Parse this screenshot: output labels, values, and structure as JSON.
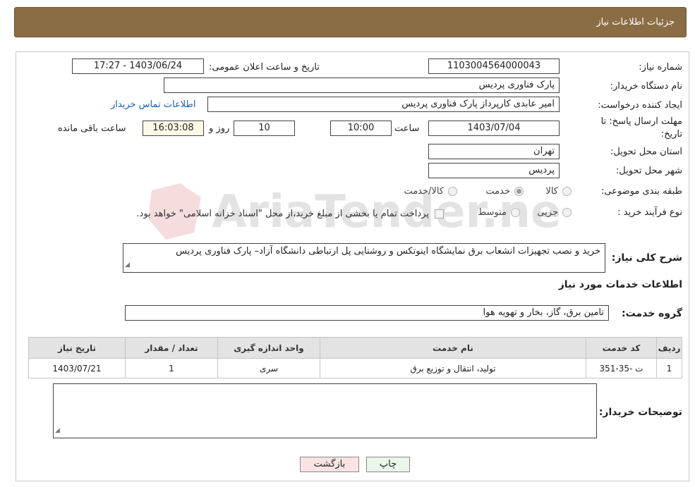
{
  "header": {
    "title": "جزئیات اطلاعات نیاز"
  },
  "fields": {
    "need_number_label": "شماره نیاز:",
    "need_number": "1103004564000043",
    "announce_label": "تاریخ و ساعت اعلان عمومی:",
    "announce_value": "1403/06/24 - 17:27",
    "buyer_org_label": "نام دستگاه خریدار:",
    "buyer_org": "پارک فناوری پردیس",
    "creator_label": "ایجاد کننده درخواست:",
    "creator": "امیر عابدی کارپرداز پارک فناوری پردیس",
    "contact_link": "اطلاعات تماس خریدار",
    "deadline_label_1": "مهلت ارسال پاسخ: تا",
    "deadline_label_2": "تاریخ:",
    "deadline_date": "1403/07/04",
    "time_label": "ساعت",
    "deadline_time": "10:00",
    "days_value": "10",
    "days_label": "روز و",
    "remaining_value": "16:03:08",
    "remaining_label": "ساعت باقی مانده",
    "province_label": "استان محل تحویل:",
    "province": "تهران",
    "city_label": "شهر محل تحویل:",
    "city": "پردیس",
    "category_label": "طبقه بندی موضوعی:",
    "category_options": [
      "کالا",
      "خدمت",
      "کالا/خدمت"
    ],
    "category_selected": "خدمت",
    "process_label": "نوع فرآیند خرید :",
    "process_options": [
      "جزیی",
      "متوسط"
    ],
    "payment_note": "پرداخت تمام یا بخشی از مبلغ خرید،از محل \"اسناد خزانه اسلامی\" خواهد بود."
  },
  "description": {
    "label": "شرح کلی نیاز:",
    "text": "خرید و نصب تجهیزات انشعاب برق نمایشگاه اینوتکس و روشنایی پل ارتباطی دانشگاه آزاد– پارک فناوری پردیس"
  },
  "services": {
    "section_title": "اطلاعات خدمات مورد نیاز",
    "group_label": "گروه خدمت:",
    "group_value": "تامین برق، گاز، بخار و تهویه هوا",
    "columns": [
      "ردیف",
      "کد خدمت",
      "نام خدمت",
      "واحد اندازه گیری",
      "تعداد / مقدار",
      "تاریخ نیاز"
    ],
    "rows": [
      [
        "1",
        "ت -35-351",
        "تولید، انتقال و توزیع برق",
        "سری",
        "1",
        "1403/07/21"
      ]
    ]
  },
  "buyer_notes": {
    "label": "توضیحات خریدار:",
    "text": ""
  },
  "buttons": {
    "print": "چاپ",
    "back": "بازگشت"
  },
  "watermark": {
    "text": "AriaTender.neT"
  },
  "colors": {
    "header_bg": "#8b6d45",
    "link": "#1a5fb4",
    "back_button_bg": "#fbe3e3",
    "print_button_bg": "#eaf7ea"
  }
}
